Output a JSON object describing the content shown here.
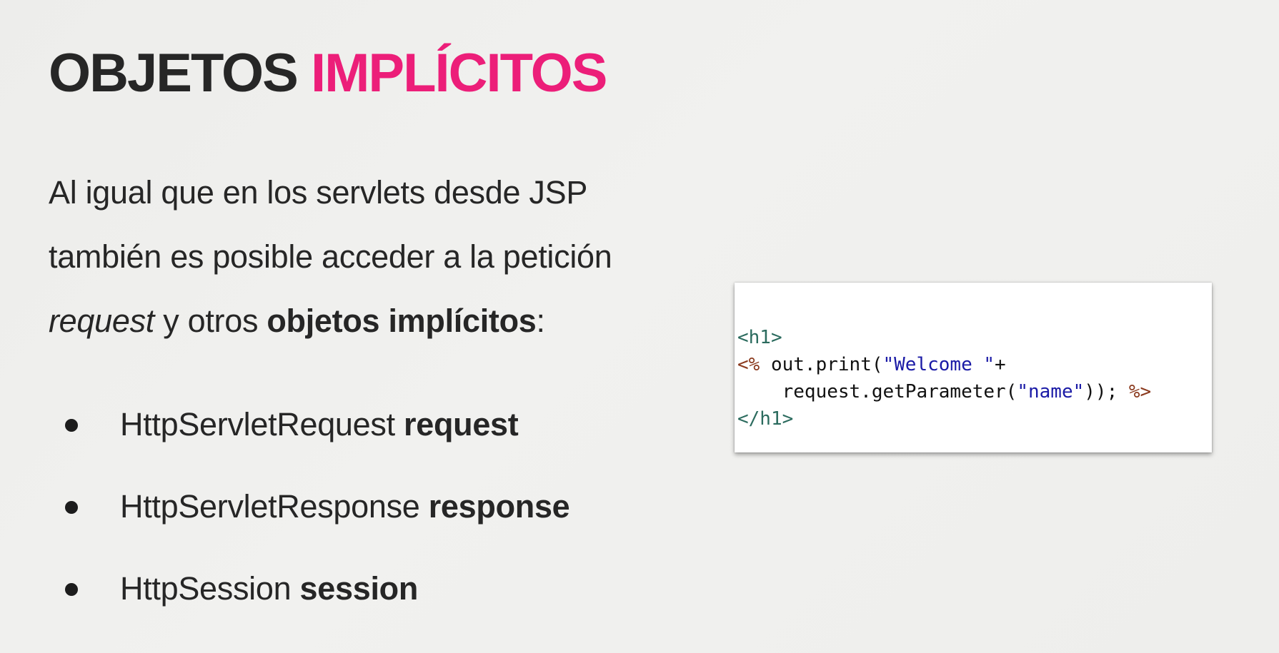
{
  "slide": {
    "title": {
      "part1": "OBJETOS",
      "part2": "IMPLÍCITOS"
    },
    "intro": {
      "line1": "Al igual que en los servlets desde JSP",
      "line2": "también es posible acceder a la petición",
      "italic_word": "request",
      "mid_text": " y otros ",
      "bold_phrase": "objetos implícitos",
      "end_punct": ":"
    },
    "bullets": [
      {
        "type": "HttpServletRequest",
        "name": "request"
      },
      {
        "type": "HttpServletResponse",
        "name": "response"
      },
      {
        "type": "HttpSession",
        "name": "session"
      }
    ]
  },
  "code": {
    "line1_tag": "<h1>",
    "line2_open": "<%",
    "line2_text": " out.print(",
    "line2_str": "\"Welcome \"",
    "line2_plus": "+",
    "line3_text": "    request.getParameter(",
    "line3_str": "\"name\"",
    "line3_close": "));",
    "line3_end": " %>",
    "line4_tag": "</h1>"
  },
  "colors": {
    "accent": "#ec1e79",
    "title_dark": "#262626",
    "background": "#efefed",
    "code_tag": "#2b6b5e",
    "code_string": "#1a1aa6",
    "code_delim": "#8b3a1e"
  }
}
